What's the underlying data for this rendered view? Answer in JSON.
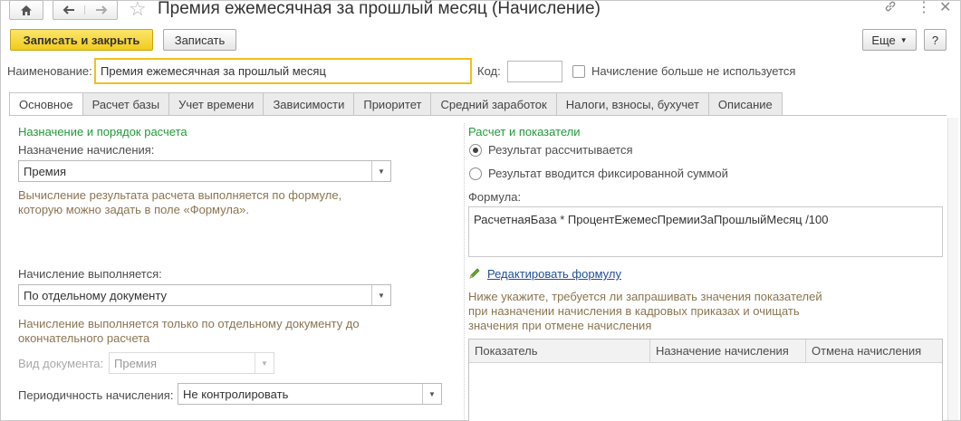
{
  "window": {
    "title": "Премия ежемесячная за прошлый месяц (Начисление)",
    "icons": [
      "home-icon",
      "back-arrow-icon",
      "forward-arrow-icon",
      "star-icon",
      "link-icon",
      "more-icon",
      "close-icon"
    ]
  },
  "toolbar": {
    "save_close_label": "Записать и закрыть",
    "save_label": "Записать",
    "more_label": "Еще",
    "help_label": "?"
  },
  "header": {
    "name_label": "Наименование:",
    "name_value": "Премия ежемесячная за прошлый месяц",
    "code_label": "Код:",
    "code_value": "",
    "unused_label": "Начисление больше не используется"
  },
  "tabs": [
    {
      "label": "Основное",
      "active": true
    },
    {
      "label": "Расчет базы",
      "active": false
    },
    {
      "label": "Учет времени",
      "active": false
    },
    {
      "label": "Зависимости",
      "active": false
    },
    {
      "label": "Приоритет",
      "active": false
    },
    {
      "label": "Средний заработок",
      "active": false
    },
    {
      "label": "Налоги, взносы, бухучет",
      "active": false
    },
    {
      "label": "Описание",
      "active": false
    }
  ],
  "left": {
    "section_title": "Назначение и порядок расчета",
    "purpose_label": "Назначение начисления:",
    "purpose_value": "Премия",
    "purpose_note_1": "Вычисление результата расчета выполняется по формуле,",
    "purpose_note_2": "которую можно задать в поле «Формула».",
    "performed_label": "Начисление выполняется:",
    "performed_value": "По отдельному документу",
    "performed_note_1": "Начисление выполняется только по отдельному документу до",
    "performed_note_2": "окончательного расчета",
    "doc_type_label": "Вид документа:",
    "doc_type_value": "Премия",
    "periodicity_label": "Периодичность начисления:",
    "periodicity_value": "Не контролировать"
  },
  "right": {
    "section_title": "Расчет и показатели",
    "radio_calculated": "Результат рассчитывается",
    "radio_fixed": "Результат вводится фиксированной суммой",
    "formula_label": "Формула:",
    "formula_value": "РасчетнаяБаза * ПроцентЕжемесПремииЗаПрошлыйМесяц /100",
    "edit_formula_link": "Редактировать формулу",
    "note_1": "Ниже укажите, требуется ли запрашивать значения показателей",
    "note_2": "при назначении начисления в кадровых приказах и очищать",
    "note_3": "значения при отмене начисления",
    "table_headers": [
      "Показатель",
      "Назначение начисления",
      "Отмена начисления"
    ]
  }
}
